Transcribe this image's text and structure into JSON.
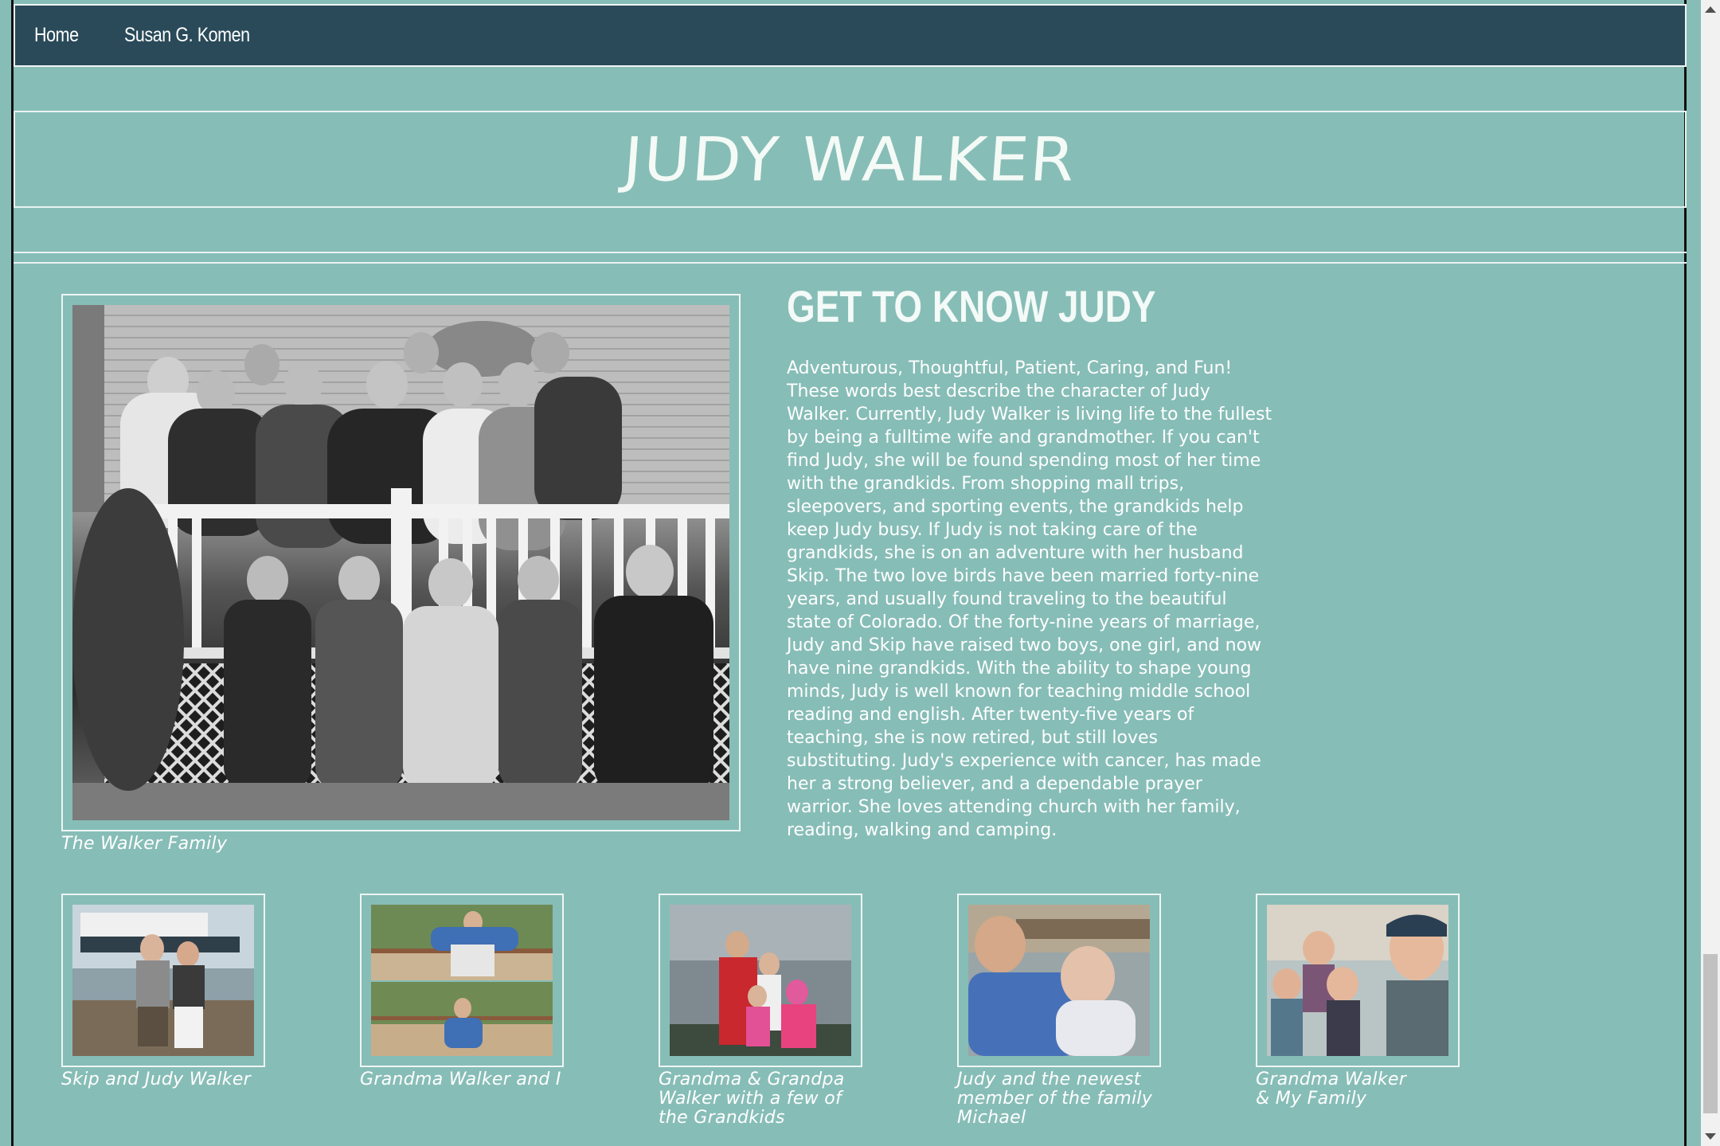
{
  "nav": {
    "items": [
      {
        "label": "Home"
      },
      {
        "label": "Susan G. Komen"
      }
    ]
  },
  "header": {
    "title": "JUDY WALKER"
  },
  "about": {
    "heading": "GET TO KNOW JUDY",
    "bio": "Adventurous, Thoughtful, Patient, Caring, and Fun! These words best describe the character of Judy Walker. Currently, Judy Walker is living life to the fullest by being a fulltime wife and grandmother. If you can't find Judy, she will be found spending most of her time with the grandkids. From shopping mall trips, sleepovers, and sporting events, the grandkids help keep Judy busy. If Judy is not taking care of the grandkids, she is on an adventure with her husband Skip. The two love birds have been married forty-nine years, and usually found traveling to the beautiful state of Colorado. Of the forty-nine years of marriage, Judy and Skip have raised two boys, one girl, and now have nine grandkids. With the ability to shape young minds, Judy is well known for teaching middle school reading and english. After twenty-five years of teaching, she is now retired, but still loves substituting. Judy's experience with cancer, has made her a strong believer, and a dependable prayer warrior. She loves attending church with her family, reading, walking and camping."
  },
  "main_photo": {
    "caption": "The Walker Family"
  },
  "gallery": [
    {
      "caption": "Skip and Judy Walker"
    },
    {
      "caption": "Grandma Walker and I"
    },
    {
      "caption": "Grandma & Grandpa Walker with a few of the Grandkids"
    },
    {
      "caption": "Judy and the newest member of the family Michael"
    },
    {
      "caption": "Grandma Walker & My Family"
    }
  ],
  "colors": {
    "background": "#87bdb7",
    "nav": "#2a4a59",
    "text": "#ffffff"
  }
}
